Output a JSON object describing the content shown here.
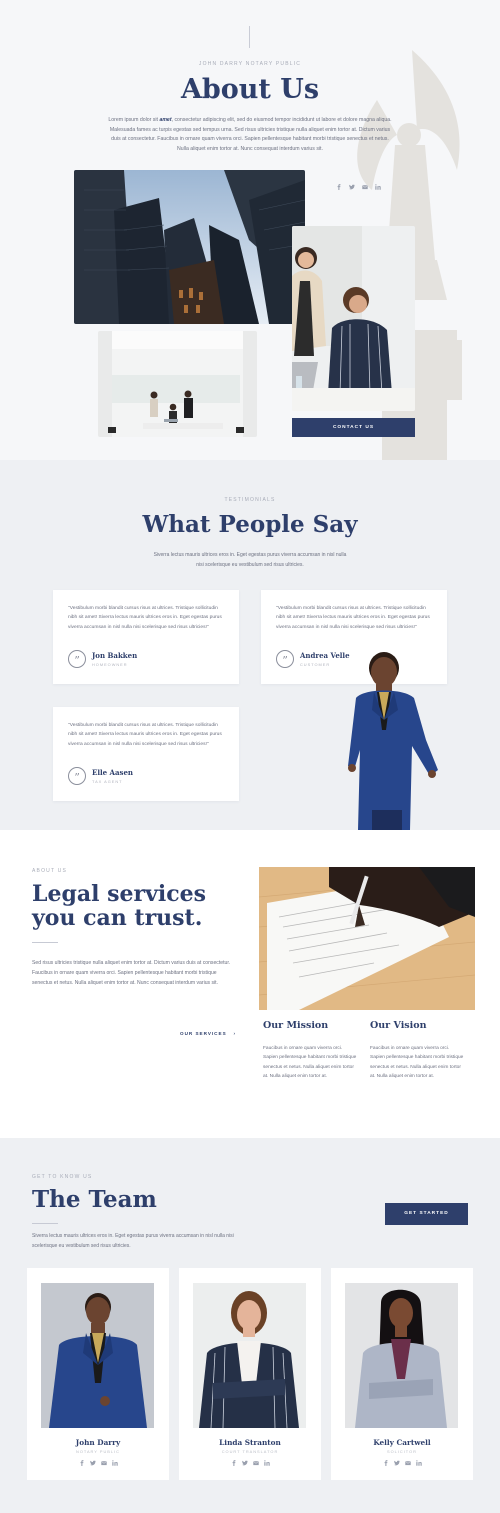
{
  "about": {
    "eyebrow": "JOHN DARRY NOTARY PUBLIC",
    "title": "About Us",
    "text_before": "Lorem ipsum dolor sit ",
    "text_emph": "amet",
    "text_after": ", consectetur adipiscing elit, sed do eiusmod tempor incididunt ut labore et dolore magna aliqua. Malesuada fames ac turpis egestas sed tempus urna. Sed risus ultricies tristique nulla aliquet enim tortor at. Dictum varius duis at consectetur. Faucibus in ornare quam viverra orci. Sapien pellentesque habitant morbi tristique senectus et netus. Nulla aliquet enim tortor at. Nunc consequat interdum varius sit.",
    "social": [
      "facebook-icon",
      "twitter-icon",
      "email-icon",
      "linkedin-icon"
    ],
    "contact_button": "CONTACT US"
  },
  "testimonials": {
    "eyebrow": "TESTIMONIALS",
    "title": "What People Say",
    "subtitle": "Siverra lectus mauris ultrices eros in. Eget egestas purus viverra accumsan in nisl nulla nisi scelerisque eu vestibulum sed risus ultricies.",
    "items": [
      {
        "quote": "\"Vestibulum morbi blandit cursus risus at ultrices. Tristique sollicitudin nibh sit amet! Siverra lectus mauris ultrices eros in. Eget egestas purus viverra accumsan in nisl nulla nisi scelerisque sed risus ultricies!\"",
        "name": "Jon Bakken",
        "role": "HOMEOWNER"
      },
      {
        "quote": "\"Vestibulum morbi blandit cursus risus at ultrices. Tristique sollicitudin nibh sit amet! Siverra lectus mauris ultrices eros in. Eget egestas purus viverra accumsan in nisl nulla nisi scelerisque sed risus ultricies!\"",
        "name": "Andrea Velle",
        "role": "CUSTOMER"
      },
      {
        "quote": "\"Vestibulum morbi blandit cursus risus at ultrices. Tristique sollicitudin nibh sit amet! Siverra lectus mauris ultrices eros in. Eget egestas purus viverra accumsan in nisl nulla nisi scelerisque sed risus ultricies!\"",
        "name": "Elle Aasen",
        "role": "TAX AGENT"
      }
    ]
  },
  "legal": {
    "eyebrow": "ABOUT US",
    "title": "Legal services you can trust.",
    "text": "Sed risus ultricies tristique nulla aliquet enim tortor at. Dictum varius duis at consectetur. Faucibus in ornare quam viverra orci. Sapien pellentesque habitant morbi tristique senectus et netus. Nulla aliquet enim tortor at. Nunc consequat interdum varius sit.",
    "services_link": "OUR SERVICES",
    "services_arrow": "›",
    "mission_title": "Our Mission",
    "mission_text": "Faucibus in ornare quam viverra orci. Sapien pellentesque habitant morbi tristique senectus et netus. Nulla aliquet enim tortor at. Nulla aliquet enim tortor at.",
    "vision_title": "Our Vision",
    "vision_text": "Faucibus in ornare quam viverra orci. Sapien pellentesque habitant morbi tristique senectus et netus. Nulla aliquet enim tortor at. Nulla aliquet enim tortor at."
  },
  "team": {
    "eyebrow": "GET TO KNOW US",
    "title": "The Team",
    "subtitle": "Siverra lectus mauris ultrices eros in. Eget egestas purus viverra accumsan in nisl nulla nisi scelerisque eu vestibulum sed risus ultricies.",
    "button": "GET STARTED",
    "members": [
      {
        "name": "John Darry",
        "role": "NOTARY PUBLIC"
      },
      {
        "name": "Linda Stranton",
        "role": "COURT TRANSLATOR"
      },
      {
        "name": "Kelly Cartwell",
        "role": "SOLICITOR"
      }
    ]
  },
  "colors": {
    "accent": "#2e3f6b",
    "section_gray": "#eef0f3",
    "hero_bg": "#f6f7f9"
  }
}
